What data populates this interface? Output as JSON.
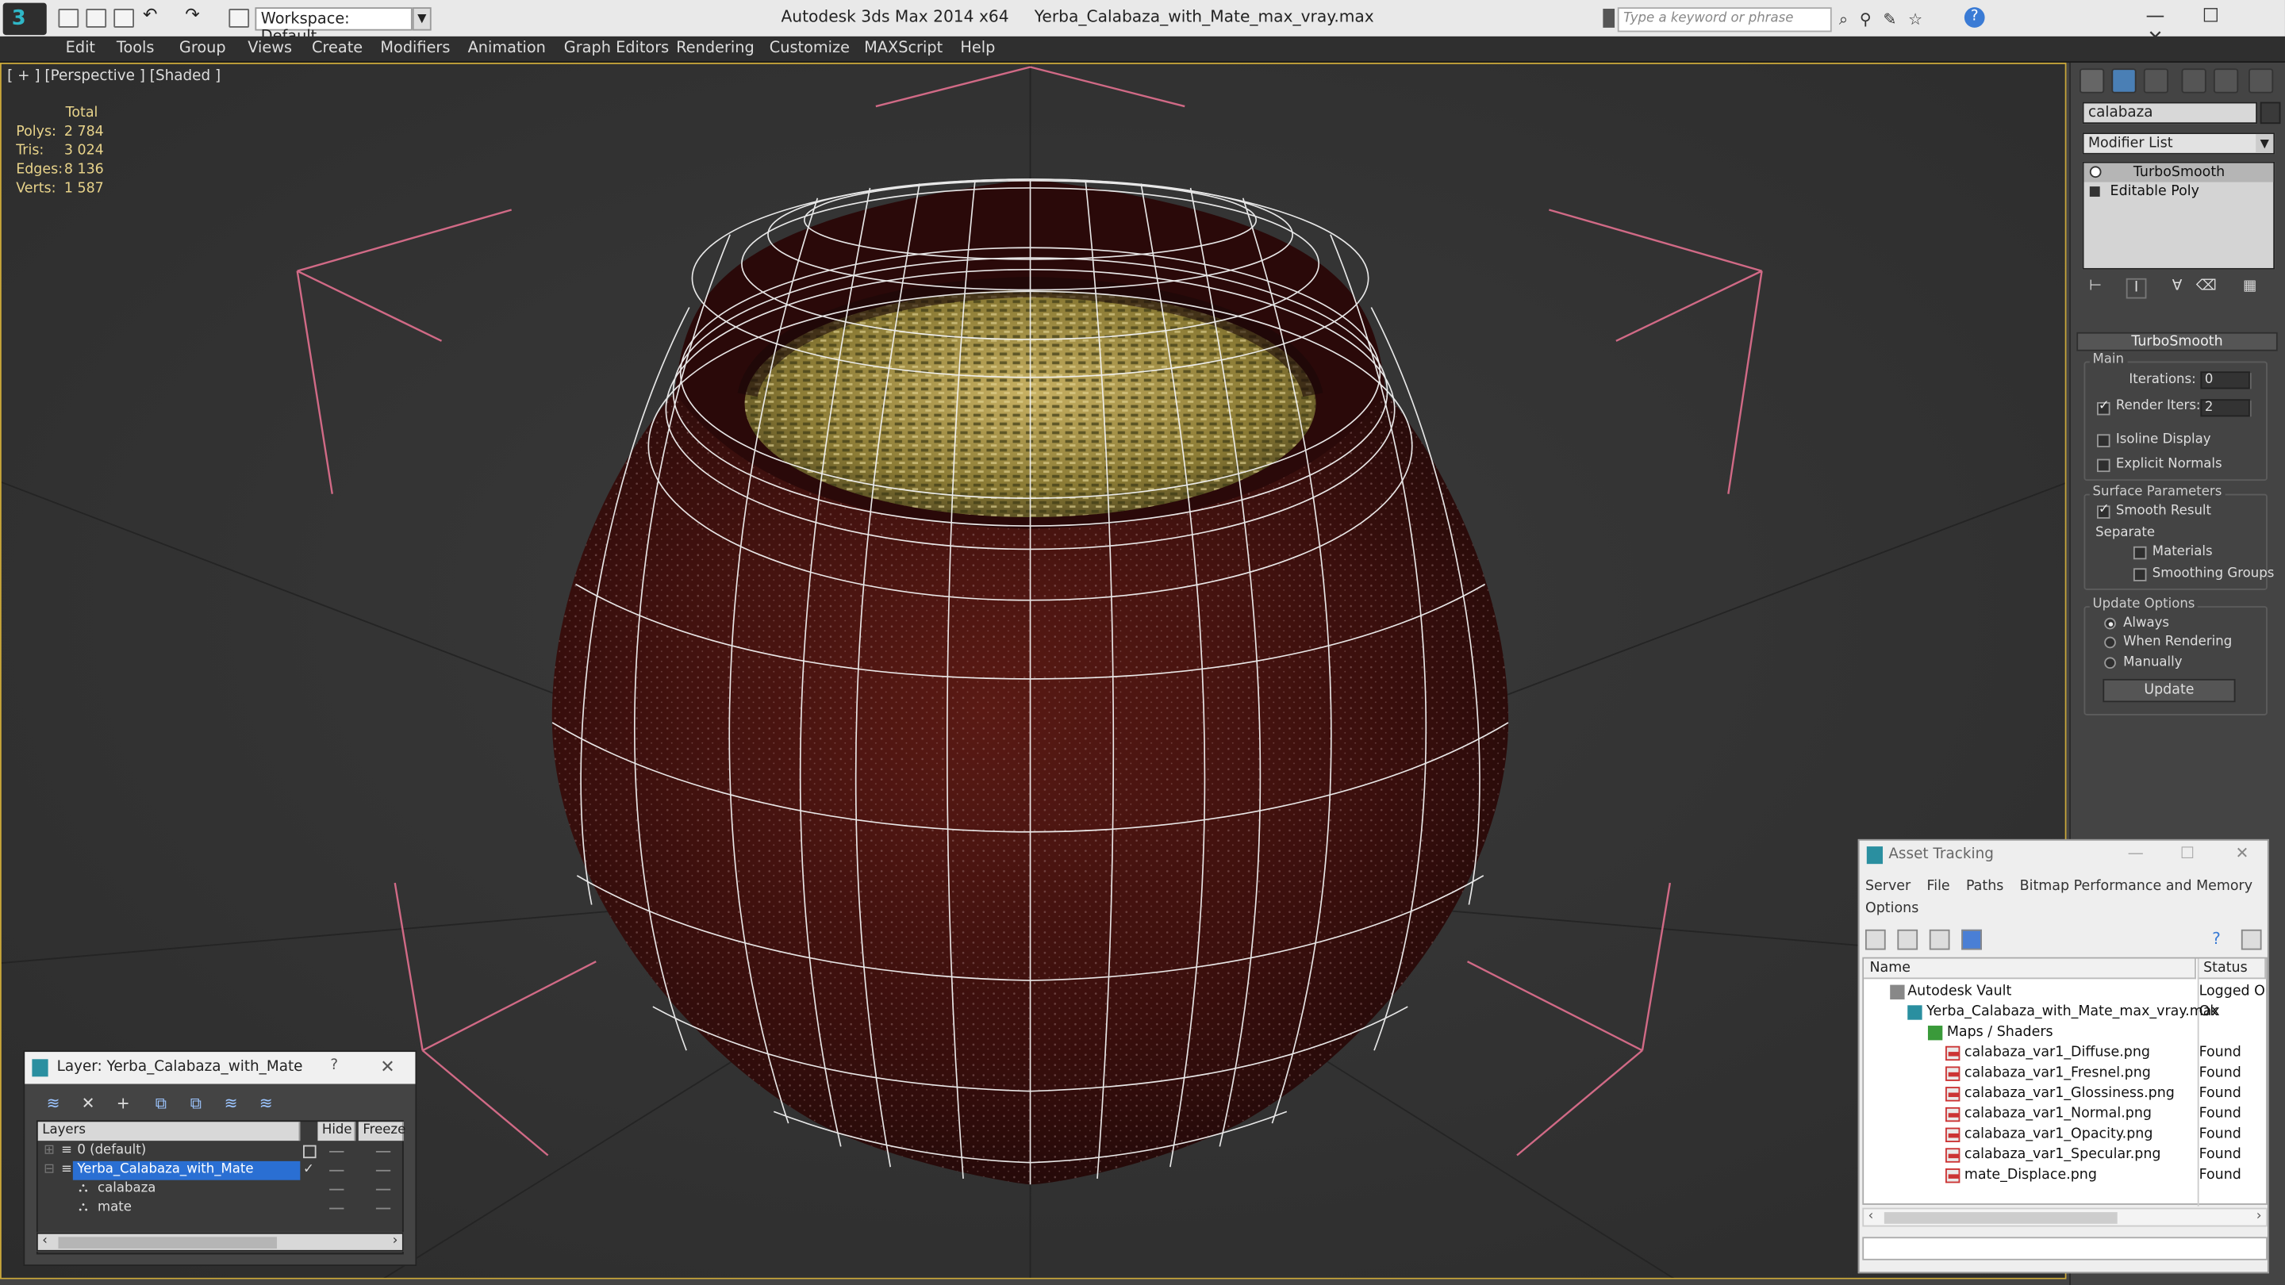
{
  "titlebar": {
    "workspace_label": "Workspace: Default",
    "app_name": "Autodesk 3ds Max  2014 x64",
    "file_name": "Yerba_Calabaza_with_Mate_max_vray.max",
    "search_placeholder": "Type a keyword or phrase",
    "help_label": "?"
  },
  "menu": [
    "Edit",
    "Tools",
    "Group",
    "Views",
    "Create",
    "Modifiers",
    "Animation",
    "Graph Editors",
    "Rendering",
    "Customize",
    "MAXScript",
    "Help"
  ],
  "viewport": {
    "label": "[ + ] [Perspective ] [Shaded ]",
    "stats_header": "Total",
    "stats": [
      {
        "k": "Polys:",
        "v": "2 784"
      },
      {
        "k": "Tris:",
        "v": "3 024"
      },
      {
        "k": "Edges:",
        "v": "8 136"
      },
      {
        "k": "Verts:",
        "v": "1 587"
      }
    ],
    "colors": {
      "wire": "#ffffff",
      "lights": "#d16a86",
      "gourd": "#4a1414",
      "yerba": "#a8923a",
      "background": "#343434"
    }
  },
  "command_panel": {
    "object_name": "calabaza",
    "modifier_list": "Modifier List",
    "stack": [
      "TurboSmooth",
      "Editable Poly"
    ],
    "rollout_title": "TurboSmooth",
    "main_group": "Main",
    "iterations_label": "Iterations:",
    "iterations_value": "0",
    "render_iters_label": "Render Iters:",
    "render_iters_value": "2",
    "isoline_label": "Isoline Display",
    "explicit_normals_label": "Explicit Normals",
    "surface_group": "Surface Parameters",
    "smooth_result_label": "Smooth Result",
    "separate_label": "Separate",
    "materials_label": "Materials",
    "smoothing_groups_label": "Smoothing Groups",
    "update_group": "Update Options",
    "always_label": "Always",
    "when_rendering_label": "When Rendering",
    "manually_label": "Manually",
    "update_button": "Update"
  },
  "layer_dialog": {
    "title": "Layer: Yerba_Calabaza_with_Mate",
    "help": "?",
    "close": "✕",
    "col_layers": "Layers",
    "col_hide": "Hide",
    "col_freeze": "Freeze",
    "rows": [
      {
        "name": "0 (default)"
      },
      {
        "name": "Yerba_Calabaza_with_Mate"
      },
      {
        "name": "calabaza"
      },
      {
        "name": "mate"
      }
    ]
  },
  "asset_dialog": {
    "title": "Asset Tracking",
    "menus": [
      "Server",
      "File",
      "Paths",
      "Bitmap Performance and Memory",
      "Options"
    ],
    "col_name": "Name",
    "col_status": "Status",
    "rows": [
      {
        "name": "Autodesk Vault",
        "status": "Logged Ou"
      },
      {
        "name": "Yerba_Calabaza_with_Mate_max_vray.max",
        "status": "Ok"
      },
      {
        "name": "Maps / Shaders",
        "status": ""
      },
      {
        "name": "calabaza_var1_Diffuse.png",
        "status": "Found"
      },
      {
        "name": "calabaza_var1_Fresnel.png",
        "status": "Found"
      },
      {
        "name": "calabaza_var1_Glossiness.png",
        "status": "Found"
      },
      {
        "name": "calabaza_var1_Normal.png",
        "status": "Found"
      },
      {
        "name": "calabaza_var1_Opacity.png",
        "status": "Found"
      },
      {
        "name": "calabaza_var1_Specular.png",
        "status": "Found"
      },
      {
        "name": "mate_Displace.png",
        "status": "Found"
      }
    ]
  }
}
